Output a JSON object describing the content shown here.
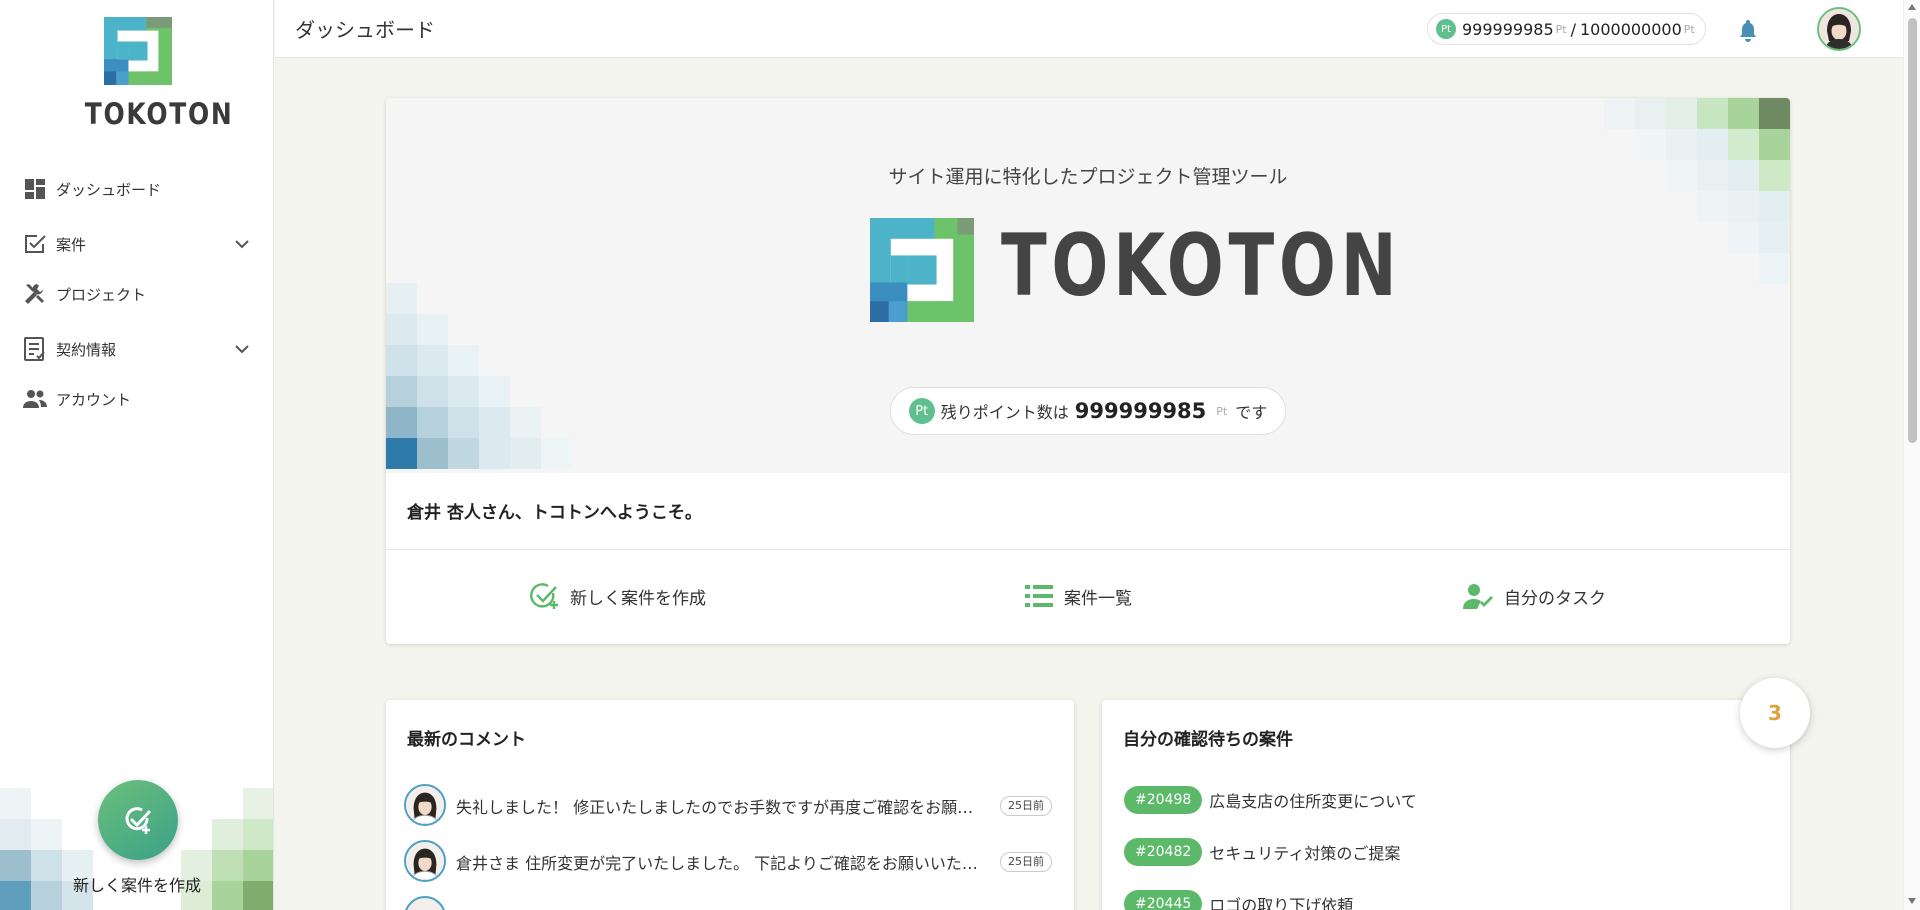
{
  "app": {
    "logo_text": "TOKOTON"
  },
  "sidebar": {
    "items": [
      {
        "label": "ダッシュボード",
        "icon": "dashboard-icon"
      },
      {
        "label": "案件",
        "icon": "task-check-icon",
        "expandable": true
      },
      {
        "label": "プロジェクト",
        "icon": "tools-icon"
      },
      {
        "label": "契約情報",
        "icon": "contract-icon",
        "expandable": true
      },
      {
        "label": "アカウント",
        "icon": "people-icon"
      }
    ],
    "fab_label": "新しく案件を作成"
  },
  "header": {
    "title": "ダッシュボード",
    "points": {
      "badge": "Pt",
      "current": "999999985",
      "unit": "Pt",
      "separator": "/",
      "total": "1000000000"
    }
  },
  "hero": {
    "tagline": "サイト運用に特化したプロジェクト管理ツール",
    "logo_text": "TOKOTON",
    "remaining": {
      "badge": "Pt",
      "prefix": "残りポイント数は",
      "value": "999999985",
      "unit": "Pt",
      "suffix": "です"
    },
    "welcome": "倉井 杏人さん、トコトンへようこそ。",
    "actions": [
      {
        "label": "新しく案件を作成",
        "icon": "add-task-icon"
      },
      {
        "label": "案件一覧",
        "icon": "list-icon"
      },
      {
        "label": "自分のタスク",
        "icon": "user-check-icon"
      }
    ]
  },
  "comments_card": {
    "title": "最新のコメント",
    "items": [
      {
        "text": "失礼しました！ 修正いたしましたのでお手数ですが再度ご確認をお願いいたします。",
        "time": "25日前"
      },
      {
        "text": "倉井さま 住所変更が完了いたしました。 下記よりご確認をお願いいたします。",
        "time": "25日前"
      }
    ]
  },
  "pending_card": {
    "title": "自分の確認待ちの案件",
    "count": "3",
    "items": [
      {
        "id": "#20498",
        "title": "広島支店の住所変更について"
      },
      {
        "id": "#20482",
        "title": "セキュリティ対策のご提案"
      },
      {
        "id": "#20445",
        "title": "ロゴの取り下げ依頼"
      }
    ]
  },
  "colors": {
    "accent": "#5db96a",
    "brand_blue": "#4db3c9",
    "count": "#e0a23a"
  }
}
